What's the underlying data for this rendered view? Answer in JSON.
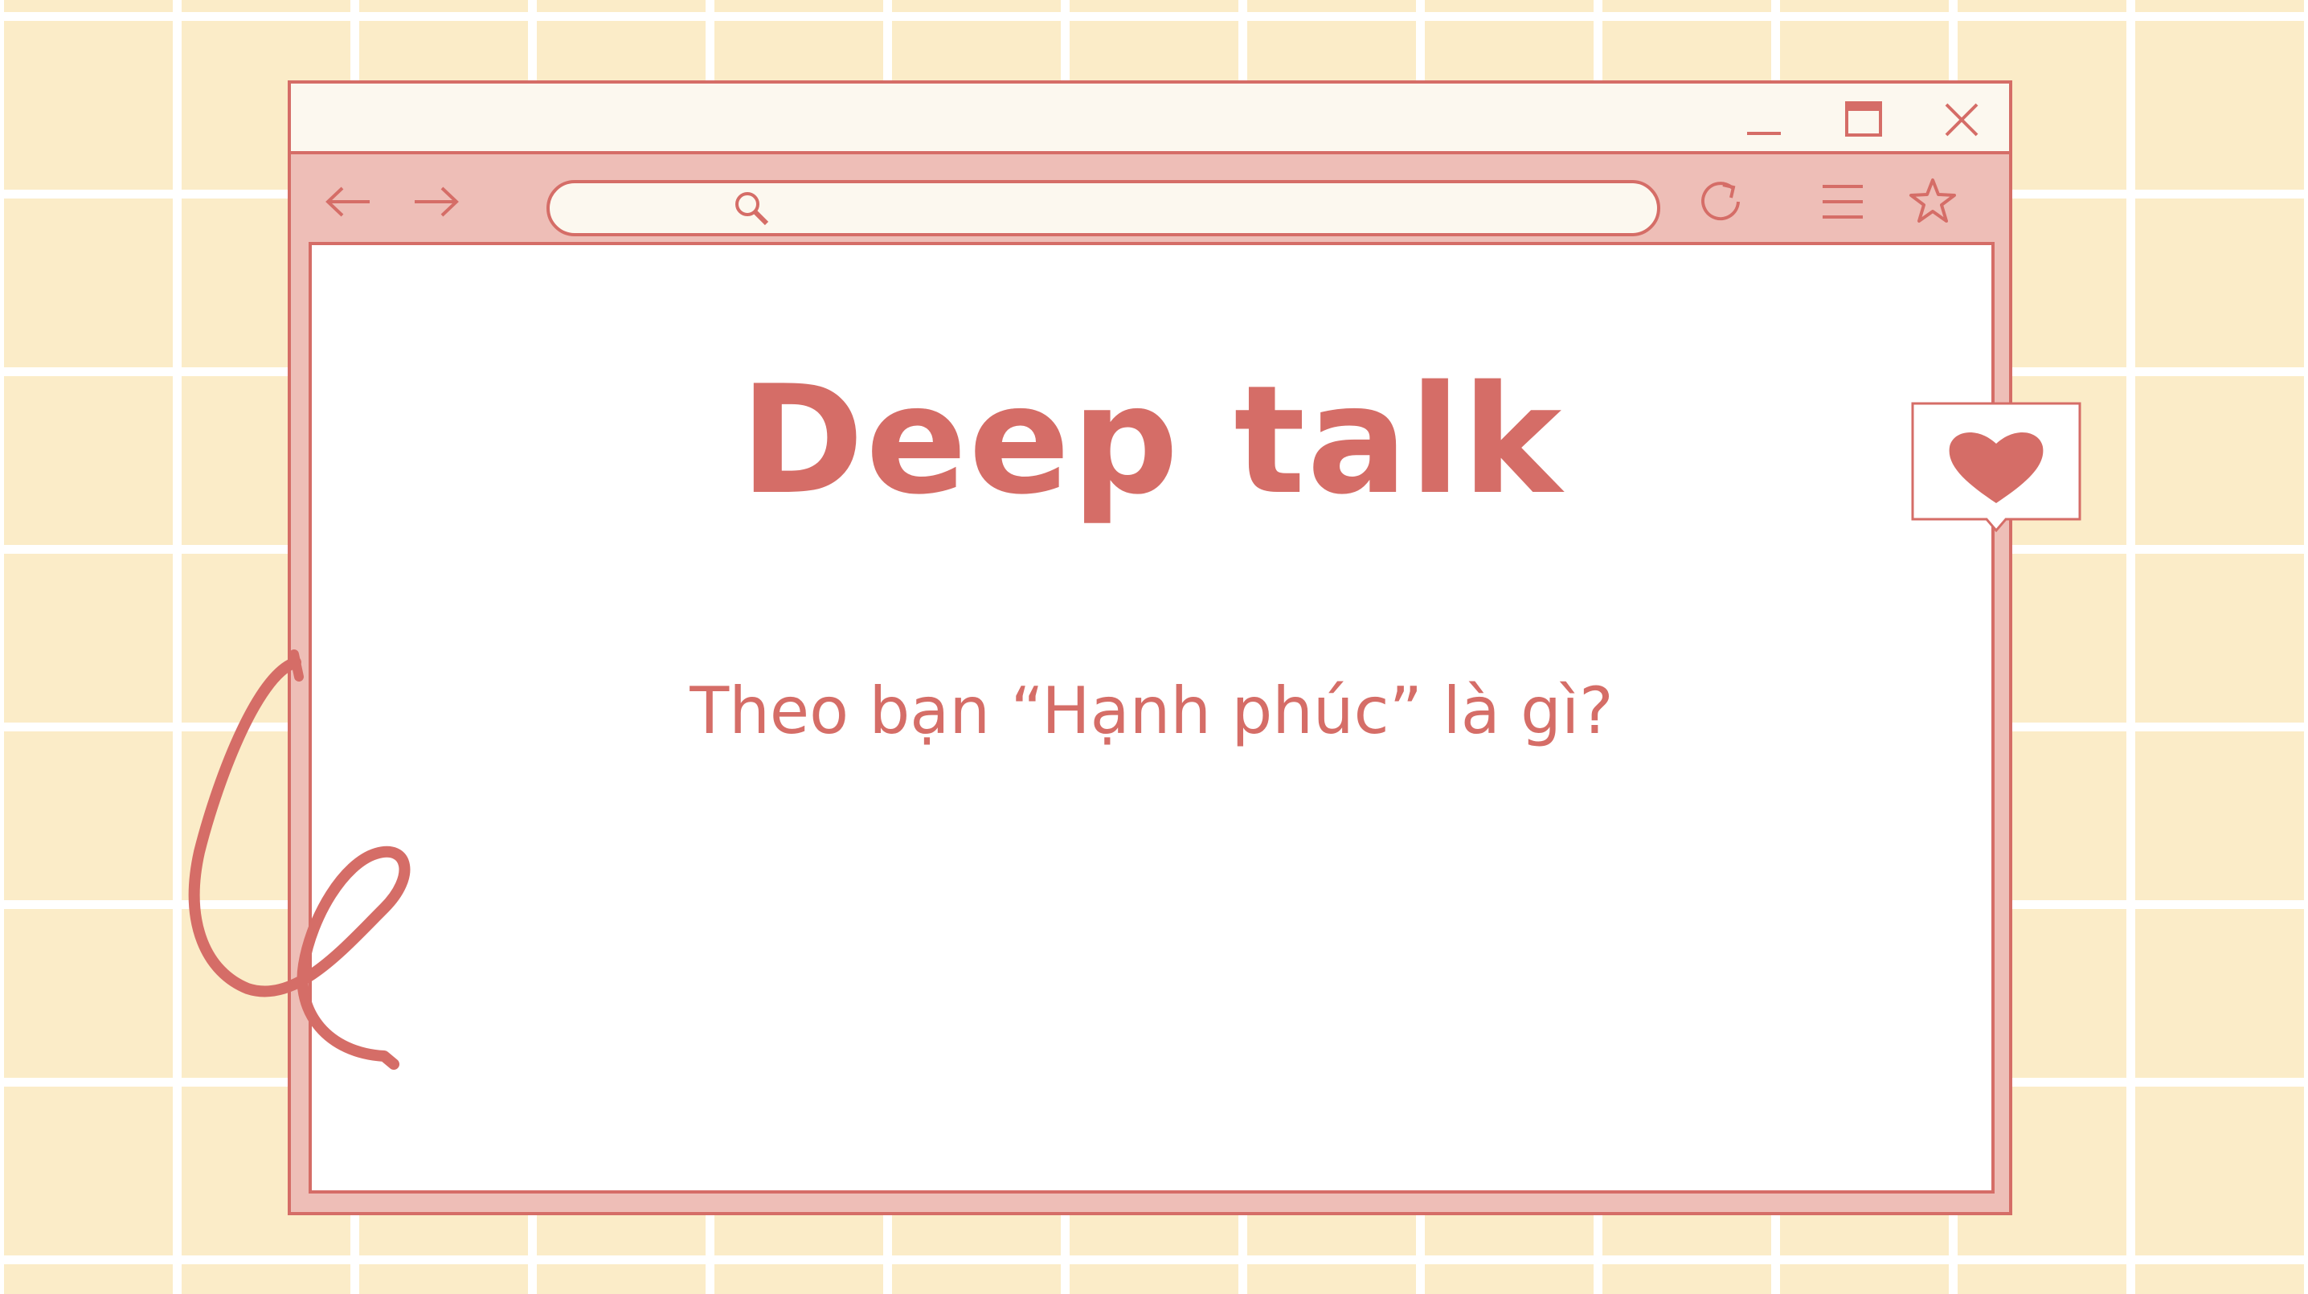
{
  "browser": {
    "window_controls": {
      "minimize_icon": "minimize-icon",
      "maximize_icon": "maximize-icon",
      "close_icon": "close-icon"
    },
    "toolbar": {
      "back_icon": "arrow-left-icon",
      "forward_icon": "arrow-right-icon",
      "search_icon": "search-icon",
      "reload_icon": "reload-icon",
      "menu_icon": "hamburger-menu-icon",
      "bookmark_icon": "star-icon"
    },
    "address_bar": {
      "value": "",
      "placeholder": ""
    }
  },
  "page": {
    "title": "Deep talk",
    "question": "Theo bạn “Hạnh phúc” là gì?"
  },
  "decorations": {
    "like_bubble_icon": "heart-icon",
    "squiggle": "squiggle-line"
  },
  "colors": {
    "accent": "#d56d67",
    "frame_fill": "#eebeb7",
    "titlebar_fill": "#fcf8ef",
    "background_tile": "#fbecc8",
    "grid_line": "#ffffff"
  }
}
